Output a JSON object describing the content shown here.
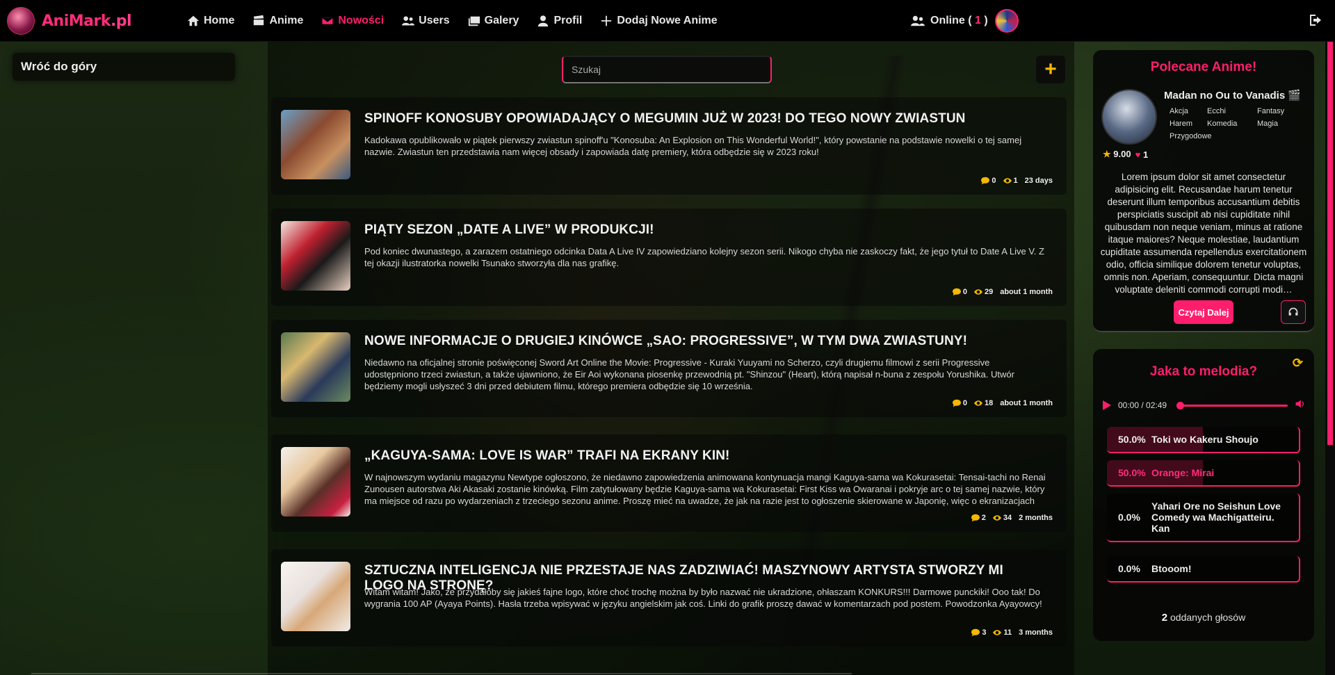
{
  "brand": {
    "part1": "AniMark",
    "part2": ".pl"
  },
  "nav": [
    {
      "label": "Home",
      "icon": "home-icon",
      "active": false
    },
    {
      "label": "Anime",
      "icon": "clapperboard-icon",
      "active": false
    },
    {
      "label": "Nowości",
      "icon": "envelope-icon",
      "active": true
    },
    {
      "label": "Users",
      "icon": "users-icon",
      "active": false
    },
    {
      "label": "Galery",
      "icon": "gallery-icon",
      "active": false
    },
    {
      "label": "Profil",
      "icon": "user-icon",
      "active": false
    },
    {
      "label": "Dodaj Nowe Anime",
      "icon": "plus-icon",
      "active": false
    }
  ],
  "online": {
    "label": "Online (",
    "count": "1",
    "close": ")"
  },
  "left": {
    "back_to_top": "Wróć do góry"
  },
  "search": {
    "placeholder": "Szukaj"
  },
  "add_button": "+",
  "news": [
    {
      "title": "SPINOFF KONOSUBY OPOWIADAJĄCY O MEGUMIN JUŻ W 2023! DO TEGO NOWY ZWIASTUN",
      "text": "Kadokawa opublikowało w piątek pierwszy zwiastun spinoff'u \"Konosuba: An Explosion on This Wonderful World!\", który powstanie na podstawie nowelki o tej samej nazwie. Zwiastun ten przedstawia nam więcej obsady i zapowiada datę premiery, która odbędzie się w 2023 roku!",
      "comments": "0",
      "views": "1",
      "age": "23 days"
    },
    {
      "title": "PIĄTY SEZON „DATE A LIVE” W PRODUKCJI!",
      "text": "Pod koniec dwunastego, a zarazem ostatniego odcinka Data A Live IV zapowiedziano kolejny sezon serii. Nikogo chyba nie zaskoczy fakt, że jego tytuł to Date A Live V. Z tej okazji ilustratorka nowelki Tsunako stworzyła dla nas grafikę.",
      "comments": "0",
      "views": "29",
      "age": "about 1 month"
    },
    {
      "title": "NOWE INFORMACJE O DRUGIEJ KINÓWCE „SAO: PROGRESSIVE”, W TYM DWA ZWIASTUNY!",
      "text": "Niedawno na oficjalnej stronie poświęconej Sword Art Online the Movie: Progressive - Kuraki Yuuyami no Scherzo, czyli drugiemu filmowi z serii Progressive udostępniono trzeci zwiastun, a także ujawniono, że Eir Aoi wykonana piosenkę przewodnią pt. \"Shinzou\" (Heart), którą napisał n-buna z zespołu Yorushika. Utwór będziemy mogli usłyszeć 3 dni przed debiutem filmu, którego premiera odbędzie się 10 września.",
      "comments": "0",
      "views": "18",
      "age": "about 1 month"
    },
    {
      "title": "„KAGUYA-SAMA: LOVE IS WAR” TRAFI NA EKRANY KIN!",
      "text": "W najnowszym wydaniu magazynu Newtype ogłoszono, że niedawno zapowiedzenia animowana kontynuacja mangi Kaguya-sama wa Kokurasetai: Tensai-tachi no Renai Zunousen autorstwa Aki Akasaki zostanie kinówką. Film zatytułowany będzie Kaguya-sama wa Kokurasetai: First Kiss wa Owaranai i pokryje arc o tej samej nazwie, który ma miejsce od razu po wydarzeniach z trzeciego sezonu anime. Proszę mieć na uwadze, że jak na razie jest to ogłoszenie skierowane w Japonię, więc o ekranizacjach poza oceanem nic jeszcze nie…",
      "comments": "2",
      "views": "34",
      "age": "2 months"
    },
    {
      "title": "SZTUCZNA INTELIGENCJA NIE PRZESTAJE NAS ZADZIWIAĆ! MASZYNOWY ARTYSTA STWORZY MI LOGO NA STRONĘ?",
      "text": "Witam witam! Jako, że przydałoby się jakieś fajne logo, które choć trochę można by było nazwać nie ukradzione, ohłaszam KONKURS!!! Darmowe punckiki! Ooo tak! Do wygrania 100 AP (Ayaya Points). Hasła trzeba wpisywać w języku angielskim jak coś. Linki do grafik proszę dawać w komentarzach pod postem. Powodzonka Ayayowcy!",
      "comments": "3",
      "views": "11",
      "age": "3 months"
    }
  ],
  "recommended": {
    "heading": "Polecane Anime!",
    "name": "Madan no Ou to Vanadis",
    "genres": [
      "Akcja",
      "Ecchi",
      "Fantasy",
      "Harem",
      "Komedia",
      "Magia",
      "Przygodowe"
    ],
    "rating": "9.00",
    "likes": "1",
    "description": "Lorem ipsum dolor sit amet consectetur adipisicing elit. Recusandae harum tenetur deserunt illum temporibus accusantium debitis perspiciatis suscipit ab nisi cupiditate nihil quibusdam non neque veniam, minus at ratione itaque maiores? Neque molestiae, laudantium cupiditate assumenda repellendus exercitationem odio, officia similique dolorem tenetur voluptas, omnis non. Aperiam, consequuntur. Dicta magni voluptate deleniti commodi corrupti modi…",
    "read_more": "Czytaj Dalej"
  },
  "melody": {
    "heading": "Jaka to melodia?",
    "time": "00:00 / 02:49",
    "options": [
      {
        "pct": "50.0%",
        "label": "Toki wo Kakeru Shoujo",
        "value": 0.5,
        "highlight": false
      },
      {
        "pct": "50.0%",
        "label": "Orange: Mirai",
        "value": 0.5,
        "highlight": true
      },
      {
        "pct": "0.0%",
        "label": "Yahari Ore no Seishun Love Comedy wa Machigatteiru. Kan",
        "value": 0.0,
        "highlight": false
      },
      {
        "pct": "0.0%",
        "label": "Btooom!",
        "value": 0.0,
        "highlight": false
      }
    ],
    "votes_count": "2",
    "votes_label": "oddanych głosów"
  },
  "colors": {
    "accent": "#ff1e6d",
    "gold": "#f5b800"
  }
}
